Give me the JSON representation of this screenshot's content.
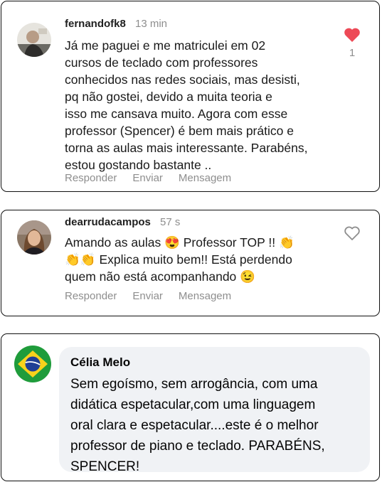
{
  "comments": [
    {
      "username": "fernandofk8",
      "time": "13 min",
      "lines": [
        "Já me paguei e me matriculei em 02",
        "cursos de teclado com professores",
        "conhecidos nas redes sociais, mas desisti,",
        "pq não  gostei, devido a muita teoria e",
        "isso me cansava muito. Agora com esse",
        "professor (Spencer) é bem mais prático e",
        "torna as aulas mais interessante. Parabéns,",
        "estou gostando bastante .."
      ],
      "like_count": "1",
      "liked": true
    },
    {
      "username": "dearrudacampos",
      "time": "57 s",
      "lines": [
        "Amando as aulas 😍 Professor TOP !! 👏",
        "👏👏 Explica muito bem!! Está perdendo",
        "quem não está acompanhando 😉"
      ],
      "liked": false
    }
  ],
  "actions": {
    "reply": "Responder",
    "send": "Enviar",
    "message": "Mensagem"
  },
  "facebook_comment": {
    "name": "Célia Melo",
    "lines": [
      "Sem egoísmo, sem arrogância, com uma",
      "didática  espetacular,com uma linguagem",
      "oral clara e espetacular....este é  o melhor",
      "professor  de piano e teclado. PARABÉNS,",
      "SPENCER!"
    ]
  },
  "colors": {
    "like_active": "#ed4956",
    "muted_text": "#8e8e8e",
    "bubble_bg": "#f0f2f5"
  }
}
